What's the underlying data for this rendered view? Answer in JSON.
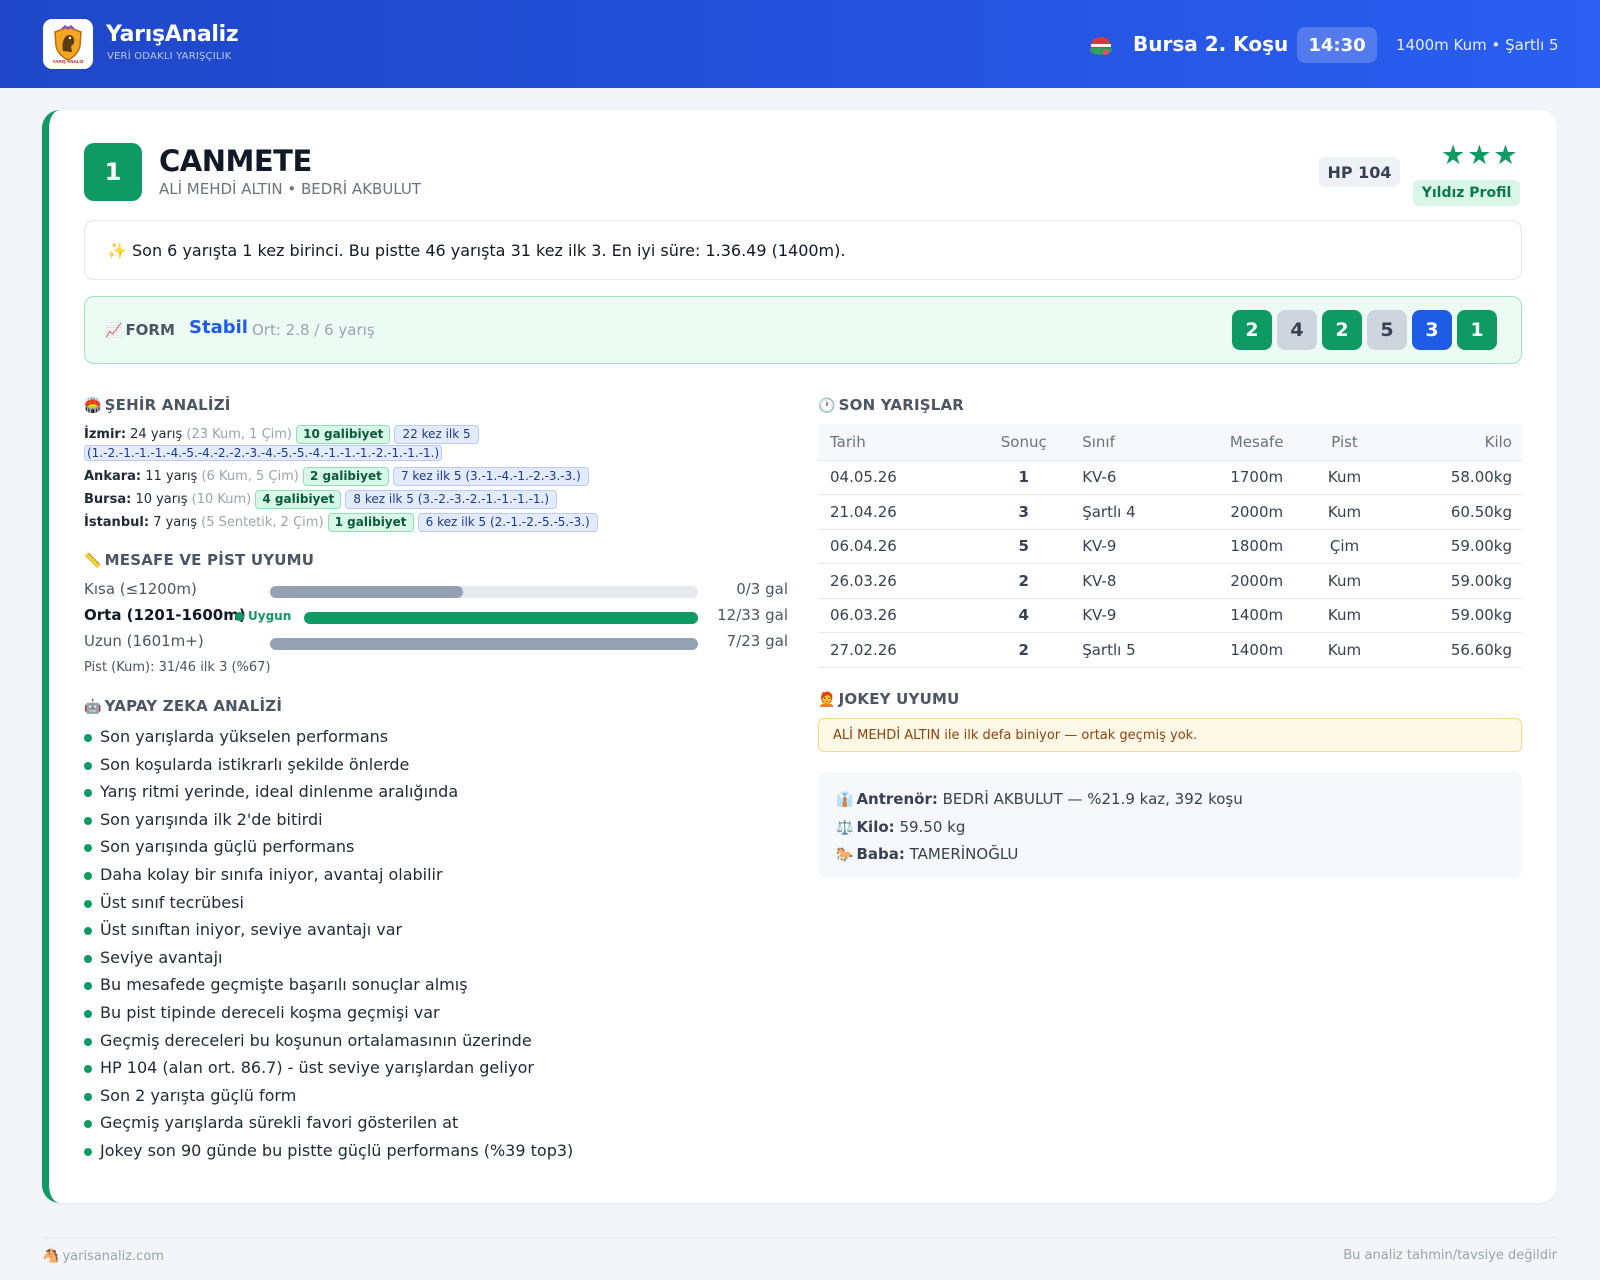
{
  "header": {
    "brand": "YarışAnaliz",
    "brand_sub": "VERİ ODAKLI YARIŞÇILIK",
    "logo_text": "YARIŞ ANALİZ",
    "race_title": "Bursa 2. Koşu",
    "race_time": "14:30",
    "race_info": "1400m Kum • Şartlı 5"
  },
  "horse": {
    "number": "1",
    "name": "CANMETE",
    "sub": "ALİ MEHDİ ALTIN • BEDRİ AKBULUT",
    "hp": "HP 104",
    "stars": "★★★",
    "star_label": "Yıldız Profil",
    "summary": "✨ Son 6 yarışta 1 kez birinci. Bu pistte 46 yarışta 31 kez ilk 3. En iyi süre: 1.36.49 (1400m)."
  },
  "form": {
    "label": "FORM",
    "trend": "Stabil",
    "avg": "Ort: 2.8 / 6 yarış",
    "chips": [
      {
        "value": "2",
        "kind": "g"
      },
      {
        "value": "4",
        "kind": "s"
      },
      {
        "value": "2",
        "kind": "g"
      },
      {
        "value": "5",
        "kind": "s"
      },
      {
        "value": "3",
        "kind": "b"
      },
      {
        "value": "1",
        "kind": "g"
      }
    ]
  },
  "city": {
    "title": "ŞEHİR ANALİZİ",
    "rows": [
      {
        "city": "İzmir:",
        "races": "24 yarış",
        "detail": "(23 Kum, 1 Çim)",
        "wins": "10 galibiyet",
        "top5": "22 kez ilk 5",
        "seq": "(1.-2.-1.-1.-1.-4.-5.-4.-2.-2.-3.-4.-5.-5.-4.-1.-1.-1.-2.-1.-1.-1.)"
      },
      {
        "city": "Ankara:",
        "races": "11 yarış",
        "detail": "(6 Kum, 5 Çim)",
        "wins": "2 galibiyet",
        "top5": "7 kez ilk 5 (3.-1.-4.-1.-2.-3.-3.)"
      },
      {
        "city": "Bursa:",
        "races": "10 yarış",
        "detail": "(10 Kum)",
        "wins": "4 galibiyet",
        "top5": "8 kez ilk 5 (3.-2.-3.-2.-1.-1.-1.-1.)"
      },
      {
        "city": "İstanbul:",
        "races": "7 yarış",
        "detail": "(5 Sentetik, 2 Çim)",
        "wins": "1 galibiyet",
        "top5": "6 kez ilk 5 (2.-1.-2.-5.-5.-3.)"
      }
    ]
  },
  "distance": {
    "title": "MESAFE VE PİST UYUMU",
    "rows": [
      {
        "label": "Kısa (≤1200m)",
        "value": "0/3 gal",
        "fill": 0.45,
        "color": "#94a0b4",
        "bold": false
      },
      {
        "label": "Orta (1201-1600m)",
        "value": "12/33 gal",
        "fill": 1.0,
        "color": "#0e9a62",
        "bold": true,
        "ok": "Uygun"
      },
      {
        "label": "Uzun (1601m+)",
        "value": "7/23 gal",
        "fill": 1.0,
        "color": "#94a0b4",
        "bold": false
      }
    ],
    "pist": "Pist (Kum): 31/46 ilk 3 (%67)"
  },
  "ai": {
    "title": "YAPAY ZEKA ANALİZİ",
    "items": [
      "Son yarışlarda yükselen performans",
      "Son koşularda istikrarlı şekilde önlerde",
      "Yarış ritmi yerinde, ideal dinlenme aralığında",
      "Son yarışında ilk 2'de bitirdi",
      "Son yarışında güçlü performans",
      "Daha kolay bir sınıfa iniyor, avantaj olabilir",
      "Üst sınıf tecrübesi",
      "Üst sınıftan iniyor, seviye avantajı var",
      "Seviye avantajı",
      "Bu mesafede geçmişte başarılı sonuçlar almış",
      "Bu pist tipinde dereceli koşma geçmişi var",
      "Geçmiş dereceleri bu koşunun ortalamasının üzerinde",
      "HP 104 (alan ort. 86.7) - üst seviye yarışlardan geliyor",
      "Son 2 yarışta güçlü form",
      "Geçmiş yarışlarda sürekli favori gösterilen at",
      "Jokey son 90 günde bu pistte güçlü performans (%39 top3)"
    ]
  },
  "races": {
    "title": "SON YARIŞLAR",
    "columns": [
      "Tarih",
      "Sonuç",
      "Sınıf",
      "Mesafe",
      "Pist",
      "Kilo"
    ],
    "rows": [
      {
        "date": "04.05.26",
        "result": "1",
        "rc": "res1",
        "class": "KV-6",
        "dist": "1700m",
        "track": "Kum",
        "kg": "58.00kg"
      },
      {
        "date": "21.04.26",
        "result": "3",
        "rc": "res3",
        "class": "Şartlı 4",
        "dist": "2000m",
        "track": "Kum",
        "kg": "60.50kg"
      },
      {
        "date": "06.04.26",
        "result": "5",
        "rc": "res5",
        "class": "KV-9",
        "dist": "1800m",
        "track": "Çim",
        "kg": "59.00kg"
      },
      {
        "date": "26.03.26",
        "result": "2",
        "rc": "res3",
        "class": "KV-8",
        "dist": "2000m",
        "track": "Kum",
        "kg": "59.00kg"
      },
      {
        "date": "06.03.26",
        "result": "4",
        "rc": "res5",
        "class": "KV-9",
        "dist": "1400m",
        "track": "Kum",
        "kg": "59.00kg"
      },
      {
        "date": "27.02.26",
        "result": "2",
        "rc": "res3",
        "class": "Şartlı 5",
        "dist": "1400m",
        "track": "Kum",
        "kg": "56.60kg"
      }
    ]
  },
  "jockey": {
    "title": "JOKEY UYUMU",
    "note": "ALİ MEHDİ ALTIN ile ilk defa biniyor — ortak geçmiş yok."
  },
  "info": {
    "trainer_label": "Antrenör:",
    "trainer_value": "BEDRİ AKBULUT — %21.9 kaz, 392 koşu",
    "weight_label": "Kilo:",
    "weight_value": "59.50 kg",
    "sire_label": "Baba:",
    "sire_value": "TAMERİNOĞLU"
  },
  "footer": {
    "site": "yarisanaliz.com",
    "disclaimer": "Bu analiz tahmin/tavsiye değildir"
  }
}
